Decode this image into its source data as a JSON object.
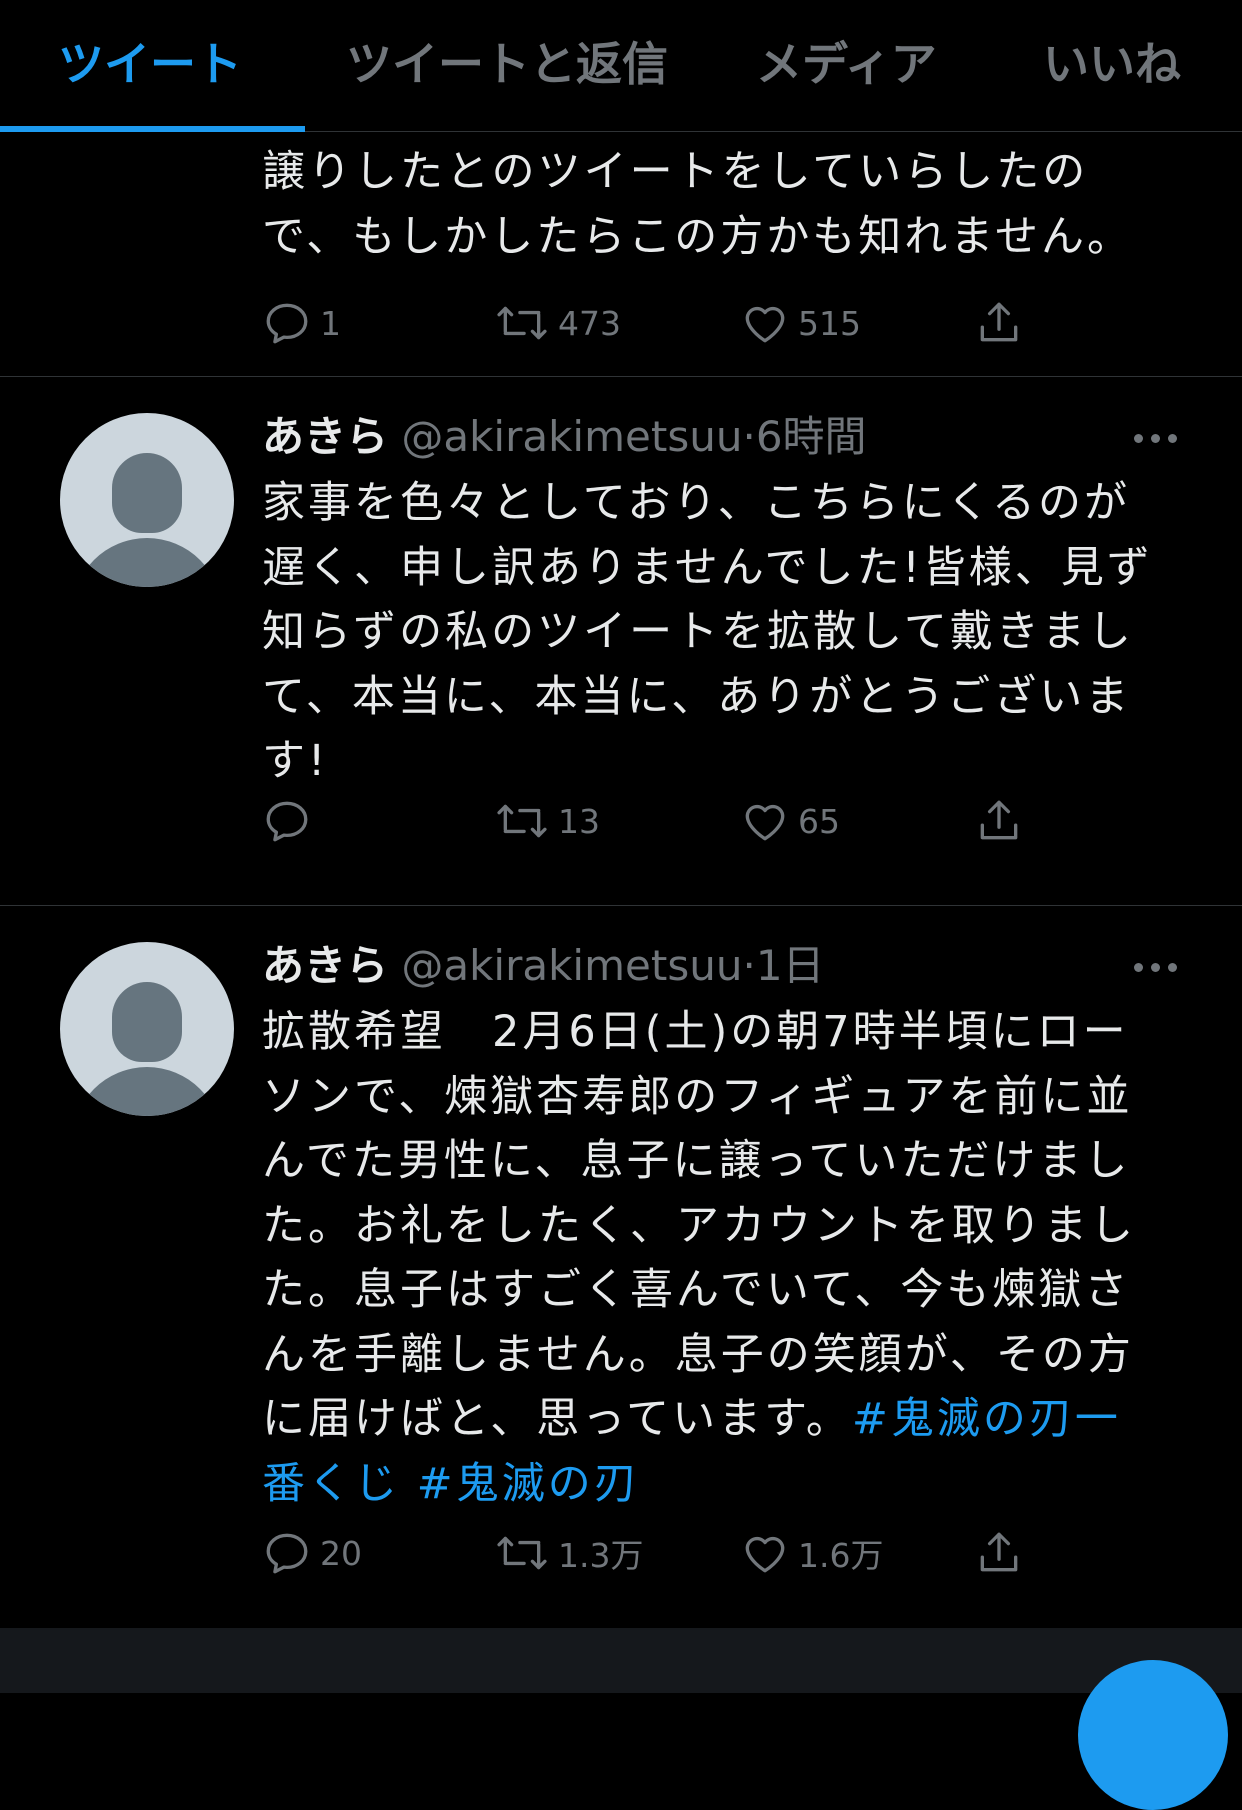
{
  "tabs": [
    {
      "label": "ツイート",
      "active": true
    },
    {
      "label": "ツイートと返信",
      "active": false
    },
    {
      "label": "メディア",
      "active": false
    },
    {
      "label": "いいね",
      "active": false
    }
  ],
  "colors": {
    "accent": "#1d9bf0",
    "background": "#000000",
    "secondary_text": "#71767b",
    "divider": "#2f3336"
  },
  "tweets": [
    {
      "text_lines": [
        "譲りしたとのツイートをしていらしたの",
        "で、もしかしたらこの方かも知れません。"
      ],
      "reply_count": "1",
      "retweet_count": "473",
      "like_count": "515"
    },
    {
      "display_name": "あきら",
      "handle": "@akirakimetsuu",
      "separator": "·",
      "time": "6時間",
      "text_lines": [
        "家事を色々としており、こちらにくるのが",
        "遅く、申し訳ありませんでした!皆様、見ず",
        "知らずの私のツイートを拡散して戴きまし",
        "て、本当に、本当に、ありがとうございま",
        "す!"
      ],
      "reply_count": "",
      "retweet_count": "13",
      "like_count": "65"
    },
    {
      "display_name": "あきら",
      "handle": "@akirakimetsuu",
      "separator": "·",
      "time": "1日",
      "text_lines": [
        "拡散希望　2月6日(土)の朝7時半頃にロー",
        "ソンで、煉獄杏寿郎のフィギュアを前に並",
        "んでた男性に、息子に譲っていただけまし",
        "た。お礼をしたく、アカウントを取りまし",
        "た。息子はすごく喜んでいて、今も煉獄さ",
        "んを手離しません。息子の笑顔が、その方"
      ],
      "line7_text": "に届けばと、思っています。",
      "hashtag1_part1": "#鬼滅の刃一",
      "hashtag1_part2": "番くじ",
      "hashtag2": "#鬼滅の刃",
      "reply_count": "20",
      "retweet_count": "1.3万",
      "like_count": "1.6万"
    }
  ]
}
